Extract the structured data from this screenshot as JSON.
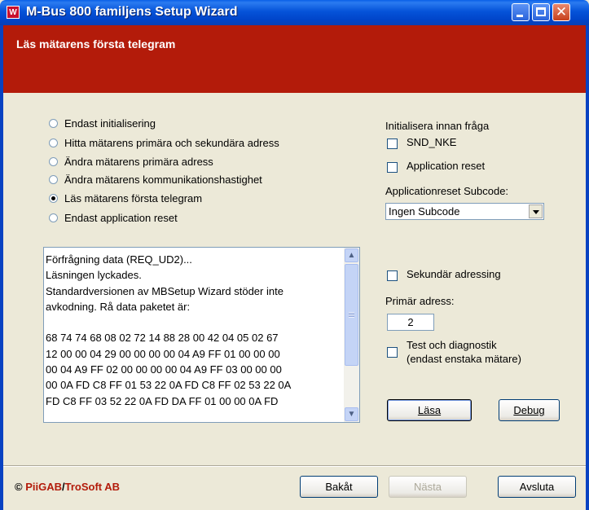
{
  "window": {
    "app_icon": "W",
    "title": "M-Bus 800 familjens Setup Wizard",
    "controls": [
      "minimize-icon",
      "maximize-icon",
      "close-icon"
    ]
  },
  "header": {
    "title": "Läs mätarens första telegram"
  },
  "options": [
    {
      "label": "Endast initialisering",
      "selected": false
    },
    {
      "label": "Hitta mätarens primära och sekundära adress",
      "selected": false
    },
    {
      "label": "Ändra mätarens primära adress",
      "selected": false
    },
    {
      "label": "Ändra mätarens kommunikationshastighet",
      "selected": false
    },
    {
      "label": "Läs mätarens första telegram",
      "selected": true
    },
    {
      "label": "Endast application reset",
      "selected": false
    }
  ],
  "output": {
    "lines": [
      "Förfrågning data (REQ_UD2)...",
      "Läsningen lyckades.",
      "Standardversionen av MBSetup Wizard stöder inte",
      "avkodning. Rå data paketet är:",
      "",
      "68 74 74 68 08 02 72 14 88 28 00 42 04 05 02 67",
      "12 00 00 04 29 00 00 00 00 04 A9 FF 01 00 00 00",
      "00 04 A9 FF 02 00 00 00 00 04 A9 FF 03 00 00 00",
      "00 0A FD C8 FF 01 53 22 0A FD C8 FF 02 53 22 0A",
      "FD C8 FF 03 52 22 0A FD DA FF 01 00 00 0A FD"
    ]
  },
  "init": {
    "heading": "Initialisera innan fråga",
    "snd_nke": {
      "label": "SND_NKE",
      "checked": false
    },
    "app_reset": {
      "label": "Application reset",
      "checked": false
    },
    "subcode_label": "Applicationreset Subcode:",
    "subcode_value": "Ingen Subcode"
  },
  "addressing": {
    "secondary": {
      "label": "Sekundär adressing",
      "checked": false
    },
    "primary_label": "Primär adress:",
    "primary_value": "2",
    "test": {
      "label_line1": "Test och diagnostik",
      "label_line2": "(endast enstaka mätare)",
      "checked": false
    }
  },
  "actions": {
    "read": "Läsa",
    "debug": "Debug"
  },
  "footer": {
    "copyright": "©",
    "brand_a": "PiiGAB",
    "slash": "/",
    "brand_b": "TroSoft AB",
    "back": "Bakåt",
    "next": "Nästa",
    "finish": "Avsluta"
  }
}
